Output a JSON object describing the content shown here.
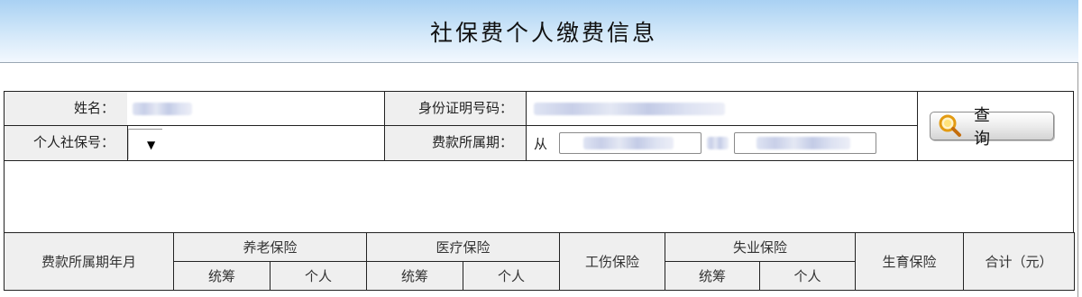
{
  "header": {
    "title": "社保费个人缴费信息"
  },
  "search": {
    "name_label": "姓名：",
    "id_label": "身份证明号码：",
    "ssn_label": "个人社保号：",
    "ssn_select_value": "▼",
    "period_label": "费款所属期：",
    "period_from": "从",
    "query_button": "查询"
  },
  "results_table": {
    "period_col": "费款所属期年月",
    "pension": "养老保险",
    "medical": "医疗保险",
    "injury": "工伤保险",
    "unemployment": "失业保险",
    "maternity": "生育保险",
    "total": "合计（元）",
    "pooled": "统筹",
    "personal": "个人"
  },
  "icons": {
    "query": "magnifier-icon",
    "dropdown": "dropdown-arrow-icon"
  },
  "colors": {
    "title_bar_top": "#a9d1f3",
    "title_bar_bottom": "#f2f8fe",
    "label_bg": "#efefef",
    "icon_accent": "#f2a91e"
  }
}
